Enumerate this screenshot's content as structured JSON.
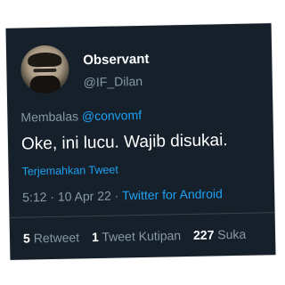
{
  "author": {
    "name": "Observant",
    "handle": "@IF_Dilan"
  },
  "reply": {
    "prefix": "Membalas",
    "mention": "@convomf"
  },
  "tweet": {
    "text": "Oke, ini lucu. Wajib disukai."
  },
  "translate_label": "Terjemahkan Tweet",
  "meta": {
    "time": "5:12",
    "separator1": " · ",
    "date": "10 Apr 22",
    "separator2": " · ",
    "source": "Twitter for Android"
  },
  "stats": {
    "retweets": {
      "count": "5",
      "label": "Retweet"
    },
    "quotes": {
      "count": "1",
      "label": "Tweet Kutipan"
    },
    "likes": {
      "count": "227",
      "label": "Suka"
    }
  },
  "colors": {
    "background": "#15202b",
    "accent": "#1da1f2",
    "muted": "#8899a6",
    "text": "#ffffff"
  }
}
